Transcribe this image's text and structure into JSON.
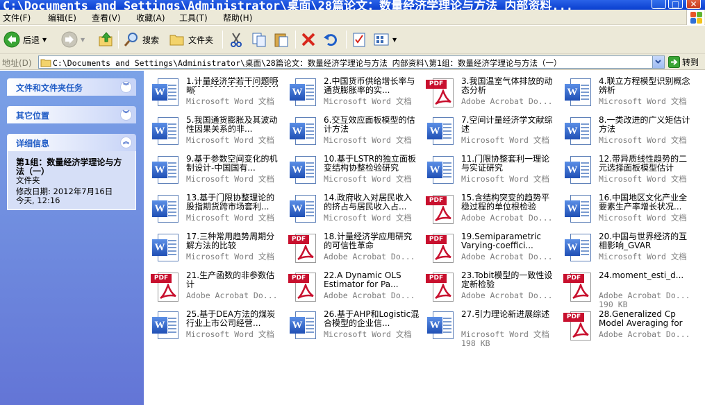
{
  "window": {
    "title": "C:\\Documents and Settings\\Administrator\\桌面\\28篇论文：数量经济学理论与方法 内部资料..."
  },
  "menu": [
    "文件(F)",
    "编辑(E)",
    "查看(V)",
    "收藏(A)",
    "工具(T)",
    "帮助(H)"
  ],
  "toolbar": {
    "back_label": "后退",
    "search_label": "搜索",
    "folders_label": "文件夹"
  },
  "address": {
    "label": "地址(D)",
    "path": "C:\\Documents and Settings\\Administrator\\桌面\\28篇论文：数量经济学理论与方法 内部资料\\第1组：数量经济学理论与方法（一）",
    "go_label": "转到"
  },
  "left_pane": {
    "tasks_title": "文件和文件夹任务",
    "places_title": "其它位置",
    "details_title": "详细信息",
    "details": {
      "name": "第1组：数量经济学理论与方法（一）",
      "kind": "文件夹",
      "modified": "修改日期: 2012年7月16日今天, 12:16"
    }
  },
  "files": [
    {
      "name": "1.计量经济学若干问题明晰",
      "type": "Microsoft Word 文档",
      "icon": "word",
      "size": ""
    },
    {
      "name": "2.中国货币供给增长率与通货膨胀率的实...",
      "type": "Microsoft Word 文档",
      "icon": "word",
      "size": ""
    },
    {
      "name": "3.我国温室气体排放的动态分析",
      "type": "Adobe Acrobat Do...",
      "icon": "pdf",
      "size": ""
    },
    {
      "name": "4.联立方程模型识别概念辨析",
      "type": "Microsoft Word 文档",
      "icon": "word",
      "size": ""
    },
    {
      "name": "5.我国通货膨胀及其波动性因果关系的非...",
      "type": "Microsoft Word 文档",
      "icon": "word",
      "size": ""
    },
    {
      "name": "6.交互效应面板模型的估计方法",
      "type": "Microsoft Word 文档",
      "icon": "word",
      "size": ""
    },
    {
      "name": "7.空间计量经济学文献综述",
      "type": "Microsoft Word 文档",
      "icon": "word",
      "size": ""
    },
    {
      "name": "8.一类改进的广义矩估计方法",
      "type": "Microsoft Word 文档",
      "icon": "word",
      "size": ""
    },
    {
      "name": "9.基于参数空间变化的机制设计-中国国有...",
      "type": "Microsoft Word 文档",
      "icon": "word",
      "size": ""
    },
    {
      "name": "10.基于LSTR的独立面板变结构协整检验研究",
      "type": "Microsoft Word 文档",
      "icon": "word",
      "size": ""
    },
    {
      "name": "11.门限协整套利一理论与实证研究",
      "type": "Microsoft Word 文档",
      "icon": "word",
      "size": ""
    },
    {
      "name": "12.带异质线性趋势的二元选择面板模型估计",
      "type": "Microsoft Word 文档",
      "icon": "word",
      "size": ""
    },
    {
      "name": "13.基于门限协整理论的股指期货跨市场套利...",
      "type": "Microsoft Word 文档",
      "icon": "word",
      "size": ""
    },
    {
      "name": "14.政府收入对居民收入的挤占与居民收入占...",
      "type": "Microsoft Word 文档",
      "icon": "word",
      "size": ""
    },
    {
      "name": "15.含结构突变的趋势平稳过程的单位根检验",
      "type": "Adobe Acrobat Do...",
      "icon": "pdf",
      "size": ""
    },
    {
      "name": "16.中国地区文化产业全要素生产率增长状况...",
      "type": "Microsoft Word 文档",
      "icon": "word",
      "size": ""
    },
    {
      "name": "17.三种常用趋势周期分解方法的比较",
      "type": "Microsoft Word 文档",
      "icon": "word",
      "size": ""
    },
    {
      "name": "18.计量经济学应用研究的可信性革命",
      "type": "Adobe Acrobat Do...",
      "icon": "pdf",
      "size": ""
    },
    {
      "name": "19.Semiparametric Varying-coeffici...",
      "type": "Adobe Acrobat Do...",
      "icon": "pdf",
      "size": ""
    },
    {
      "name": "20.中国与世界经济的互相影响_GVAR",
      "type": "Microsoft Word 文档",
      "icon": "word",
      "size": ""
    },
    {
      "name": "21.生产函数的非参数估计",
      "type": "Adobe Acrobat Do...",
      "icon": "pdf",
      "size": ""
    },
    {
      "name": "22.A Dynamic OLS Estimator for Pa...",
      "type": "Adobe Acrobat Do...",
      "icon": "pdf",
      "size": ""
    },
    {
      "name": "23.Tobit模型的一致性设定新检验",
      "type": "Adobe Acrobat Do...",
      "icon": "pdf",
      "size": ""
    },
    {
      "name": "24.moment_esti_d...",
      "type": "Adobe Acrobat Do...",
      "icon": "pdf",
      "size": "190 KB"
    },
    {
      "name": "25.基于DEA方法的煤炭行业上市公司经营...",
      "type": "Microsoft Word 文档",
      "icon": "word",
      "size": ""
    },
    {
      "name": "26.基于AHP和Logistic混合模型的企业信...",
      "type": "Microsoft Word 文档",
      "icon": "word",
      "size": ""
    },
    {
      "name": "27.引力理论新进展综述",
      "type": "Microsoft Word 文档",
      "icon": "word",
      "size": "198 KB"
    },
    {
      "name": "28.Generalized Cp Model Averaging for",
      "type": "Adobe Acrobat Do...",
      "icon": "pdf",
      "size": ""
    }
  ],
  "colors": {
    "titlebar": "#0a3fcf",
    "left_pane": "#6f8fe0",
    "panel_title": "#215dc6",
    "secondary_text": "#7d7d7d"
  }
}
